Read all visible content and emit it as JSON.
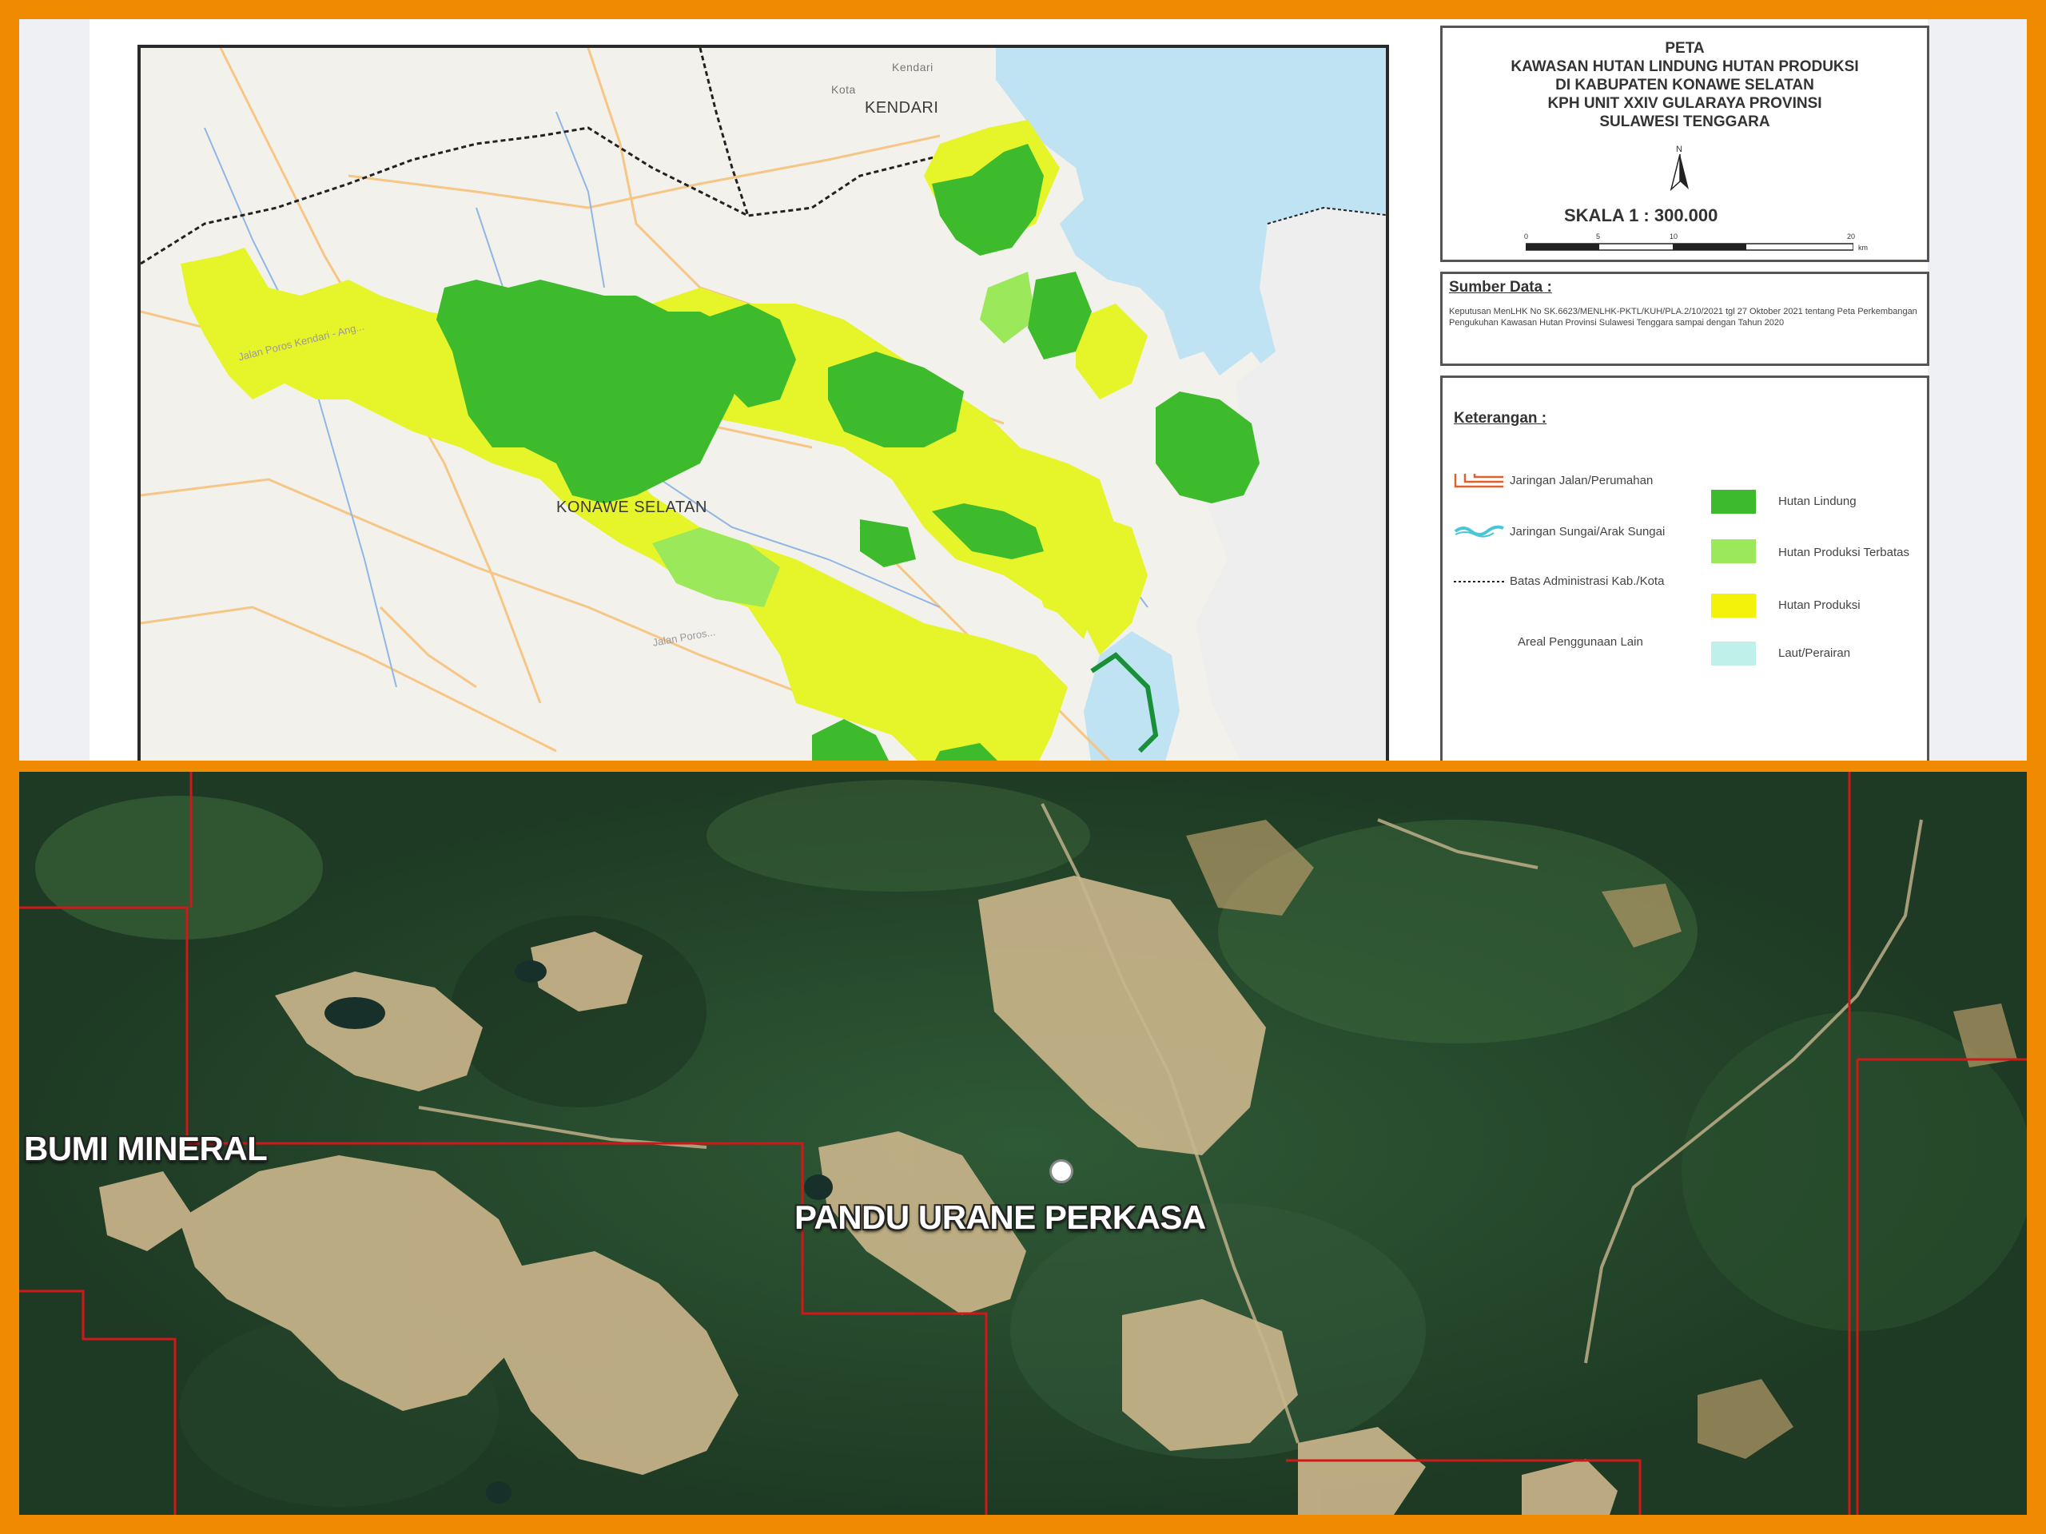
{
  "top_map": {
    "labels": {
      "kendari": "KENDARI",
      "kendari_small": "Kendari",
      "kota": "Kota",
      "konawe_selatan": "KONAWE SELATAN",
      "road_1": "Jalan Poros Kendari - Ang...",
      "road_2": "Jalan Poros..."
    },
    "title_lines": [
      "PETA",
      "KAWASAN HUTAN LINDUNG HUTAN PRODUKSI",
      "DI KABUPATEN KONAWE SELATAN",
      "KPH UNIT XXIV GULARAYA PROVINSI",
      "SULAWESI TENGGARA"
    ],
    "north": "N",
    "scale": "SKALA  1  :  300.000",
    "scale_ticks": [
      "0",
      "5",
      "10",
      "20"
    ],
    "scale_unit": "km",
    "source": {
      "title": "Sumber Data :",
      "text": "Keputusan   MenLHK   No  SK.6623/MENLHK-PKTL/KUH/PLA.2/10/2021   tgl   27 Oktober 2021 tentang Peta Perkembangan Pengukuhan Kawasan   Hutan Provinsi Sulawesi  Tenggara sampai dengan Tahun 2020"
    },
    "legend": {
      "title": "Keterangan  :",
      "left_items": [
        {
          "label": "Jaringan Jalan/Perumahan",
          "icon": "road-network-icon"
        },
        {
          "label": "Jaringan Sungai/Arak Sungai",
          "icon": "river-network-icon"
        },
        {
          "label": "Batas Administrasi Kab./Kota",
          "icon": "admin-boundary-icon"
        },
        {
          "label": "Areal Penggunaan Lain",
          "icon": ""
        }
      ],
      "right_items": [
        {
          "label": "Hutan Lindung",
          "color": "#3dbb2d"
        },
        {
          "label": "Hutan Produksi Terbatas",
          "color": "#9be85a"
        },
        {
          "label": "Hutan Produksi",
          "color": "#f4f20a"
        },
        {
          "label": "Laut/Perairan",
          "color": "#bff0ea"
        }
      ]
    }
  },
  "bottom_map": {
    "labels": {
      "left": "BUMI MINERAL",
      "center": "PANDU URANE PERKASA"
    }
  },
  "colors": {
    "frame": "#f08a00",
    "hutan_lindung": "#3dbb2d",
    "hutan_produksi": "#e6f52a",
    "sea": "#bfe3f2",
    "boundary_red": "#d01818"
  }
}
